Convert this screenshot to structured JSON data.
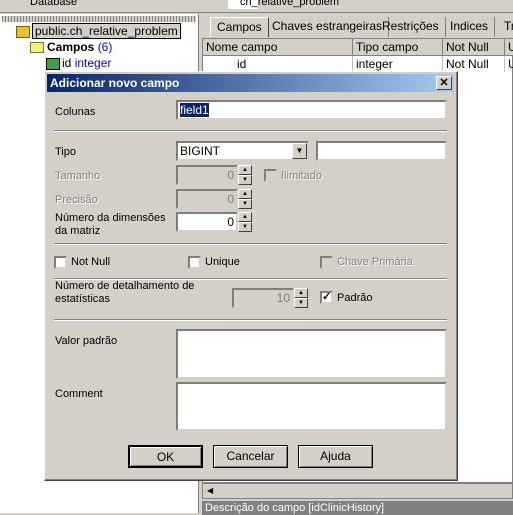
{
  "toolbar": {
    "database_label": "Database",
    "table_select": "ch_relative_problem"
  },
  "tree": {
    "root": "public.ch_relative_problem",
    "campos_label": "Campos",
    "campos_count": "(6)",
    "field_name": "id",
    "field_type": "integer"
  },
  "tabs": [
    "Campos",
    "Chaves estrangeiras",
    "Restrições",
    "Indices",
    "Trig"
  ],
  "grid": {
    "headers": [
      "Nome campo",
      "Tipo campo",
      "Not Null",
      "U"
    ],
    "rows": [
      [
        "id",
        "integer",
        "Not Null",
        "U"
      ]
    ]
  },
  "status": "Descrição do campo [idClinicHistory]",
  "dialog": {
    "title": "Adicionar novo campo",
    "colunas_label": "Colunas",
    "colunas_value": "field1",
    "tipo_label": "Tipo",
    "tipo_value": "BIGINT",
    "tipo_extra": "",
    "tamanho_label": "Tamanho",
    "tamanho_value": "0",
    "ilimitado_label": "Ilimitado",
    "precisao_label": "Precisão",
    "precisao_value": "0",
    "dimensoes_label": "Número da dimensões da matriz",
    "dimensoes_value": "0",
    "not_null_label": "Not Null",
    "unique_label": "Unique",
    "chave_label": "Chave Primária",
    "estat_label": "Número de detalhamento de estatísticas",
    "estat_value": "10",
    "padrao_label": "Padrão",
    "padrao_checked": true,
    "valor_label": "Valor padrão",
    "comment_label": "Comment",
    "ok": "OK",
    "cancelar": "Cancelar",
    "ajuda": "Ajuda"
  }
}
